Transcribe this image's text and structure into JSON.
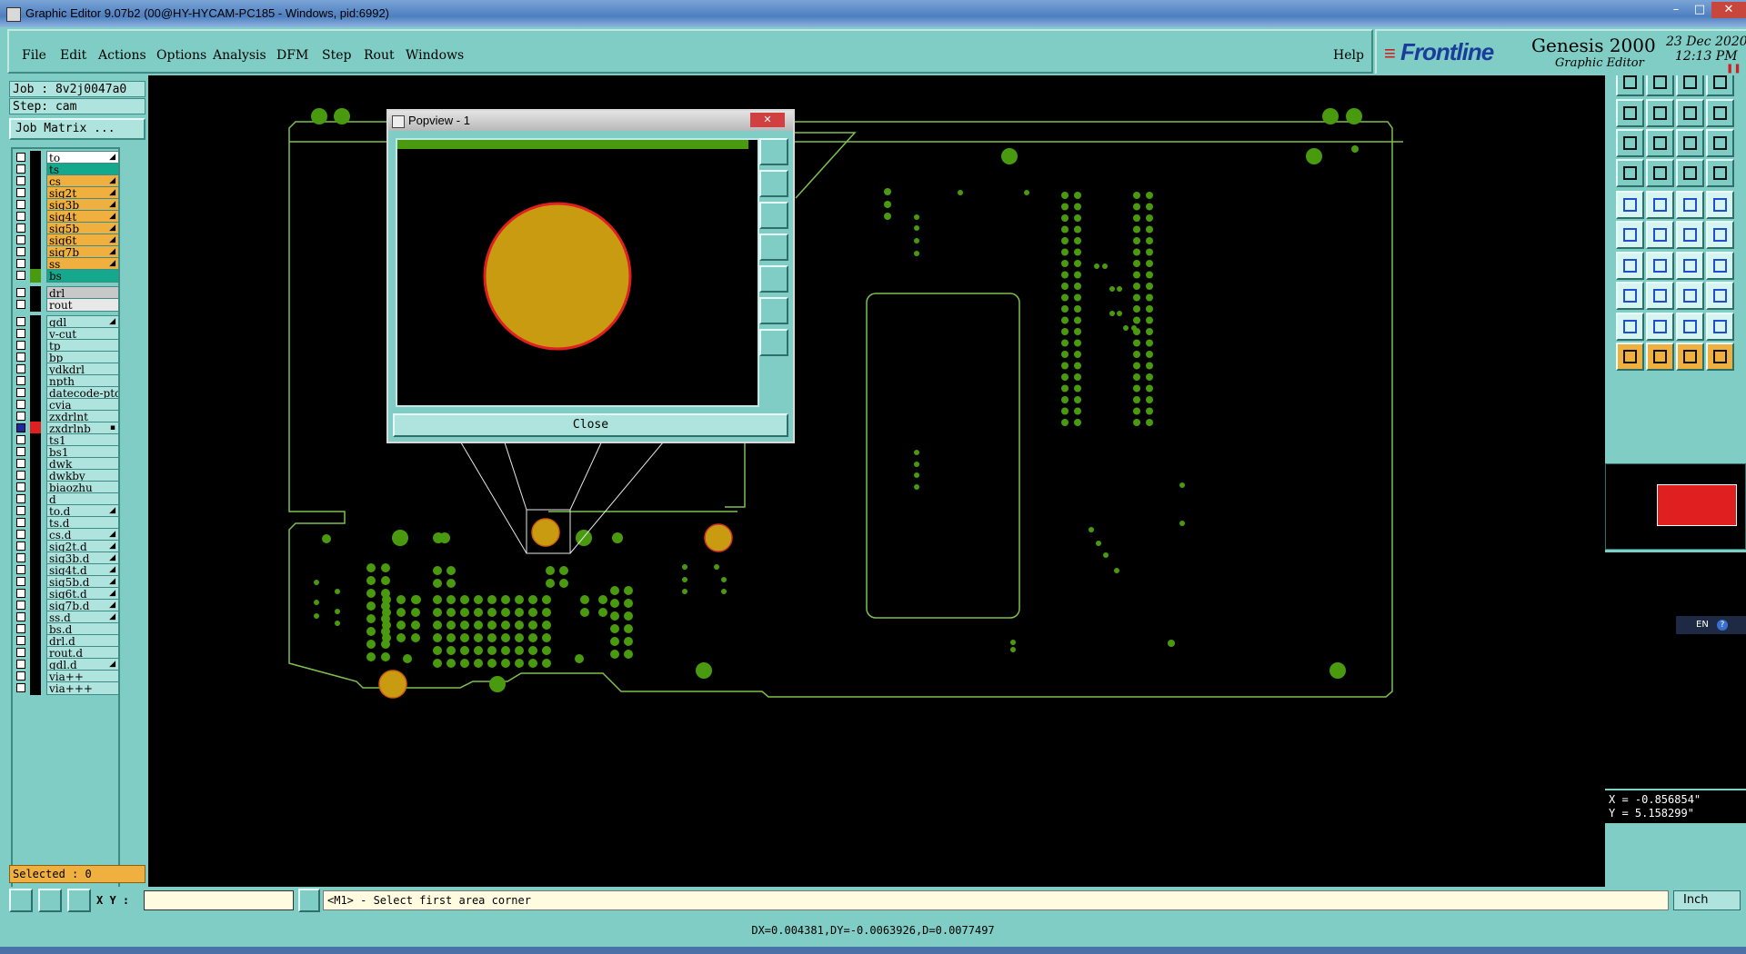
{
  "window": {
    "title": "Graphic Editor 9.07b2 (00@HY-HYCAM-PC185 - Windows, pid:6992)",
    "min": "–",
    "max": "□",
    "close": "✕"
  },
  "menu": {
    "items": [
      "File",
      "Edit",
      "Actions",
      "Options",
      "Analysis",
      "DFM",
      "Step",
      "Rout",
      "Windows"
    ],
    "help": "Help"
  },
  "brand": {
    "logo": "Frontline",
    "product": "Genesis 2000",
    "subtitle": "Graphic Editor",
    "date": "23 Dec 2020",
    "time": "12:13 PM"
  },
  "job": {
    "job_label": "Job : 8v2j0047a0",
    "step_label": "Step: cam",
    "matrix_button": "Job Matrix ...",
    "selected": "Selected : 0"
  },
  "layers": [
    {
      "name": "to",
      "color": "#ffffff",
      "mark": "◢",
      "swatch": "#000000"
    },
    {
      "name": "ts",
      "color": "#16a88c",
      "mark": "",
      "swatch": "#000000"
    },
    {
      "name": "cs",
      "color": "#f0b040",
      "mark": "◢",
      "swatch": "#000000"
    },
    {
      "name": "sig2t",
      "color": "#f0b040",
      "mark": "◢",
      "swatch": "#000000"
    },
    {
      "name": "sig3b",
      "color": "#f0b040",
      "mark": "◢",
      "swatch": "#000000"
    },
    {
      "name": "sig4t",
      "color": "#f0b040",
      "mark": "◢",
      "swatch": "#000000"
    },
    {
      "name": "sig5b",
      "color": "#f0b040",
      "mark": "◢",
      "swatch": "#000000"
    },
    {
      "name": "sig6t",
      "color": "#f0b040",
      "mark": "◢",
      "swatch": "#000000"
    },
    {
      "name": "sig7b",
      "color": "#f0b040",
      "mark": "◢",
      "swatch": "#000000"
    },
    {
      "name": "ss",
      "color": "#f0b040",
      "mark": "◢",
      "swatch": "#000000"
    },
    {
      "name": "bs",
      "color": "#16a88c",
      "mark": "",
      "swatch": "#4a9a10"
    },
    {
      "name": "drl",
      "color": "#c8c8c8",
      "mark": "",
      "swatch": "#000000"
    },
    {
      "name": "rout",
      "color": "#e8e8e8",
      "mark": "",
      "swatch": "#000000"
    },
    {
      "name": "gdl",
      "color": "#aee3de",
      "mark": "◢",
      "swatch": "#000000"
    },
    {
      "name": "v-cut",
      "color": "#aee3de",
      "mark": "",
      "swatch": "#000000"
    },
    {
      "name": "tp",
      "color": "#aee3de",
      "mark": "",
      "swatch": "#000000"
    },
    {
      "name": "bp",
      "color": "#aee3de",
      "mark": "",
      "swatch": "#000000"
    },
    {
      "name": "ydkdrl",
      "color": "#aee3de",
      "mark": "",
      "swatch": "#000000"
    },
    {
      "name": "npth",
      "color": "#aee3de",
      "mark": "",
      "swatch": "#000000"
    },
    {
      "name": "datecode-pto",
      "color": "#aee3de",
      "mark": "",
      "swatch": "#000000"
    },
    {
      "name": "cvia",
      "color": "#aee3de",
      "mark": "",
      "swatch": "#000000"
    },
    {
      "name": "zxdrlnt",
      "color": "#aee3de",
      "mark": "",
      "swatch": "#000000"
    },
    {
      "name": "zxdrlnb",
      "color": "#aee3de",
      "mark": "▪",
      "swatch": "#e02020"
    },
    {
      "name": "ts1",
      "color": "#aee3de",
      "mark": "",
      "swatch": "#000000"
    },
    {
      "name": "bs1",
      "color": "#aee3de",
      "mark": "",
      "swatch": "#000000"
    },
    {
      "name": "dwk",
      "color": "#aee3de",
      "mark": "",
      "swatch": "#000000"
    },
    {
      "name": "dwkby",
      "color": "#aee3de",
      "mark": "",
      "swatch": "#000000"
    },
    {
      "name": "biaozhu",
      "color": "#aee3de",
      "mark": "",
      "swatch": "#000000"
    },
    {
      "name": "d",
      "color": "#aee3de",
      "mark": "",
      "swatch": "#000000"
    },
    {
      "name": "to.d",
      "color": "#aee3de",
      "mark": "◢",
      "swatch": "#000000"
    },
    {
      "name": "ts.d",
      "color": "#aee3de",
      "mark": "",
      "swatch": "#000000"
    },
    {
      "name": "cs.d",
      "color": "#aee3de",
      "mark": "◢",
      "swatch": "#000000"
    },
    {
      "name": "sig2t.d",
      "color": "#aee3de",
      "mark": "◢",
      "swatch": "#000000"
    },
    {
      "name": "sig3b.d",
      "color": "#aee3de",
      "mark": "◢",
      "swatch": "#000000"
    },
    {
      "name": "sig4t.d",
      "color": "#aee3de",
      "mark": "◢",
      "swatch": "#000000"
    },
    {
      "name": "sig5b.d",
      "color": "#aee3de",
      "mark": "◢",
      "swatch": "#000000"
    },
    {
      "name": "sig6t.d",
      "color": "#aee3de",
      "mark": "◢",
      "swatch": "#000000"
    },
    {
      "name": "sig7b.d",
      "color": "#aee3de",
      "mark": "◢",
      "swatch": "#000000"
    },
    {
      "name": "ss.d",
      "color": "#aee3de",
      "mark": "◢",
      "swatch": "#000000"
    },
    {
      "name": "bs.d",
      "color": "#aee3de",
      "mark": "",
      "swatch": "#000000"
    },
    {
      "name": "drl.d",
      "color": "#aee3de",
      "mark": "",
      "swatch": "#000000"
    },
    {
      "name": "rout.d",
      "color": "#aee3de",
      "mark": "",
      "swatch": "#000000"
    },
    {
      "name": "gdl.d",
      "color": "#aee3de",
      "mark": "◢",
      "swatch": "#000000"
    },
    {
      "name": "via++",
      "color": "#aee3de",
      "mark": "",
      "swatch": "#000000"
    },
    {
      "name": "via+++",
      "color": "#aee3de",
      "mark": "",
      "swatch": "#000000"
    }
  ],
  "popview": {
    "title": "Popview - 1",
    "close_label": "Close"
  },
  "status": {
    "xy_label": "X Y :",
    "xy_value": "",
    "prompt": "<M1> - Select first area corner",
    "dx_line": "DX=0.004381,DY=-0.0063926,D=0.0077497",
    "coord_x": "X = -0.856854\"",
    "coord_y": "Y = 5.158299\"",
    "units": "Inch",
    "lang": "EN"
  },
  "colors": {
    "panel": "#7fcdc5",
    "board_outline": "#7ec050",
    "pad_green": "#4a9a10",
    "pad_gold": "#c89b10",
    "highlight_red": "#e02020"
  }
}
